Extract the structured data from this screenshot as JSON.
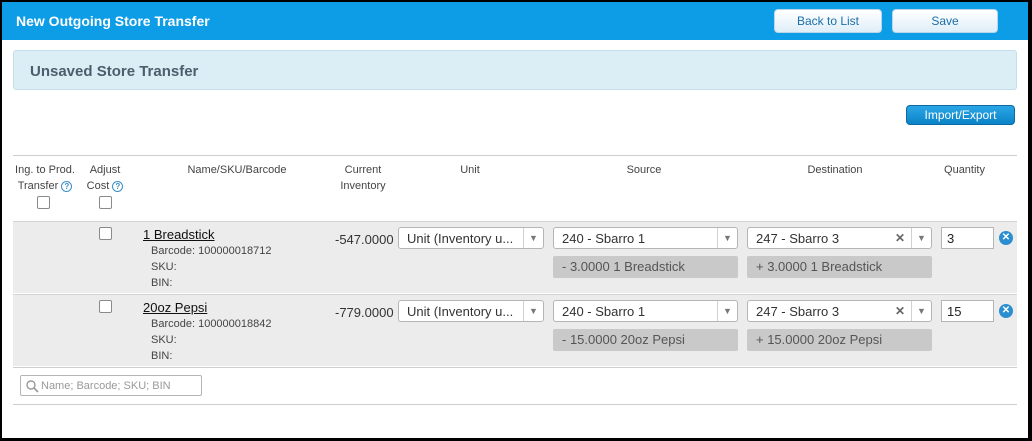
{
  "header": {
    "title": "New Outgoing Store Transfer",
    "back_label": "Back to List",
    "save_label": "Save"
  },
  "banner": {
    "text": "Unsaved Store Transfer"
  },
  "toolbar": {
    "import_export_label": "Import/Export"
  },
  "columns": {
    "ing_to_prod_line1": "Ing. to Prod.",
    "ing_to_prod_line2": "Transfer",
    "adjust_cost_line1": "Adjust",
    "adjust_cost_line2": "Cost",
    "name": "Name/SKU/Barcode",
    "current_inventory_line1": "Current",
    "current_inventory_line2": "Inventory",
    "unit": "Unit",
    "source": "Source",
    "destination": "Destination",
    "quantity": "Quantity"
  },
  "items": [
    {
      "name": "1 Breadstick",
      "barcode": "Barcode: 100000018712",
      "sku": "SKU:",
      "bin": "BIN:",
      "current_inventory": "-547.0000",
      "unit": "Unit (Inventory u...",
      "source": "240 - Sbarro 1",
      "source_note": "- 3.0000 1 Breadstick",
      "destination": "247 - Sbarro 3",
      "destination_note": "+ 3.0000 1 Breadstick",
      "quantity": "3"
    },
    {
      "name": "20oz Pepsi",
      "barcode": "Barcode: 100000018842",
      "sku": "SKU:",
      "bin": "BIN:",
      "current_inventory": "-779.0000",
      "unit": "Unit (Inventory u...",
      "source": "240 - Sbarro 1",
      "source_note": "- 15.0000 20oz Pepsi",
      "destination": "247 - Sbarro 3",
      "destination_note": "+ 15.0000 20oz Pepsi",
      "quantity": "15"
    }
  ],
  "search": {
    "placeholder": "Name; Barcode; SKU; BIN"
  },
  "icons": {
    "help": "help-icon",
    "dropdown": "chevron-down-icon",
    "clear": "close-icon",
    "remove": "remove-circle-icon",
    "search": "search-icon"
  },
  "colors": {
    "topbar": "#0d9ce6",
    "banner": "#dbeef6",
    "row_bg": "#ececec",
    "accent": "#2a8ed0"
  }
}
